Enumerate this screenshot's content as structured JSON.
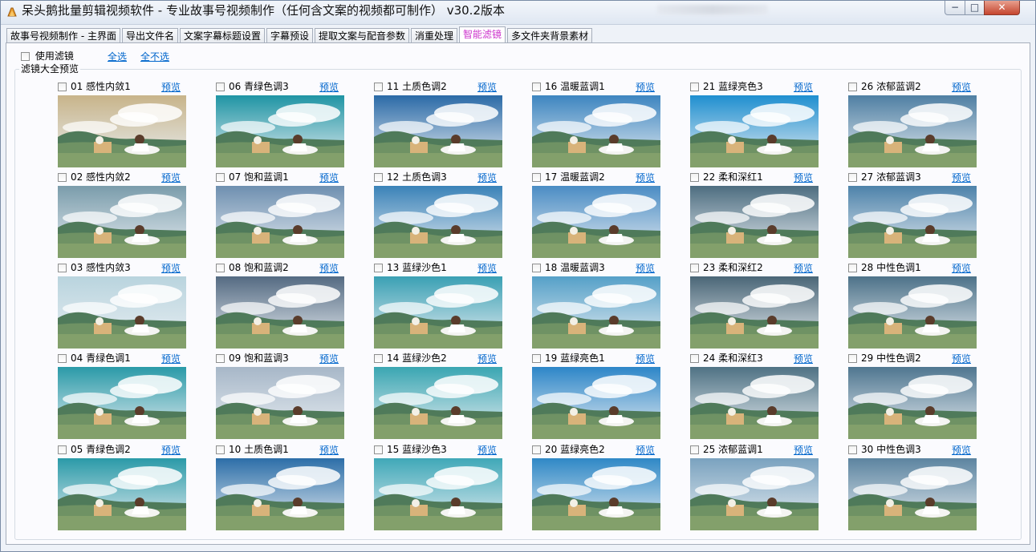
{
  "window": {
    "title": "呆头鹅批量剪辑视频软件 -  专业故事号视频制作（任何含文案的视频都可制作） v30.2版本",
    "controls": [
      "−",
      "□",
      "✕"
    ]
  },
  "tabs": [
    {
      "label": "故事号视频制作 - 主界面",
      "active": false
    },
    {
      "label": "导出文件名",
      "active": false
    },
    {
      "label": "文案字幕标题设置",
      "active": false
    },
    {
      "label": "字幕预设",
      "active": false
    },
    {
      "label": "提取文案与配音参数",
      "active": false
    },
    {
      "label": "消重处理",
      "active": false
    },
    {
      "label": "智能滤镜",
      "active": true
    },
    {
      "label": "多文件夹背景素材",
      "active": false
    }
  ],
  "options": {
    "use_filter_label": "使用滤镜",
    "select_all": "全选",
    "select_none": "全不选"
  },
  "group_title": "滤镜大全预览",
  "preview_link": "预览",
  "filters": [
    {
      "label": "01 感性内敛1",
      "tint": "#c8b48a"
    },
    {
      "label": "02 感性内敛2",
      "tint": "#7a9cab"
    },
    {
      "label": "03 感性内敛3",
      "tint": "#b9d4de"
    },
    {
      "label": "04 青绿色调1",
      "tint": "#2a9aa8"
    },
    {
      "label": "05 青绿色调2",
      "tint": "#2a9aa8"
    },
    {
      "label": "06 青绿色调3",
      "tint": "#1f94a4"
    },
    {
      "label": "07 饱和蓝调1",
      "tint": "#6e8fb0"
    },
    {
      "label": "08 饱和蓝调2",
      "tint": "#546a82"
    },
    {
      "label": "09 饱和蓝调3",
      "tint": "#a7b7c8"
    },
    {
      "label": "10 土质色调1",
      "tint": "#2c6ea8"
    },
    {
      "label": "11 土质色调2",
      "tint": "#2b6aa7"
    },
    {
      "label": "12 土质色调3",
      "tint": "#3a82b8"
    },
    {
      "label": "13 蓝绿沙色1",
      "tint": "#3aa0b4"
    },
    {
      "label": "14 蓝绿沙色2",
      "tint": "#3aa6b2"
    },
    {
      "label": "15 蓝绿沙色3",
      "tint": "#3fa8b8"
    },
    {
      "label": "16 温暖蓝调1",
      "tint": "#3d85c0"
    },
    {
      "label": "17 温暖蓝调2",
      "tint": "#4a8cc4"
    },
    {
      "label": "18 温暖蓝调3",
      "tint": "#55a0c8"
    },
    {
      "label": "19 蓝绿亮色1",
      "tint": "#2d86c8"
    },
    {
      "label": "20 蓝绿亮色2",
      "tint": "#2f88c6"
    },
    {
      "label": "21 蓝绿亮色3",
      "tint": "#1f8fd0"
    },
    {
      "label": "22 柔和深红1",
      "tint": "#4d6d80"
    },
    {
      "label": "23 柔和深红2",
      "tint": "#4a6677"
    },
    {
      "label": "24 柔和深红3",
      "tint": "#4f7284"
    },
    {
      "label": "25 浓郁蓝调1",
      "tint": "#7aa2bf"
    },
    {
      "label": "26 浓郁蓝调2",
      "tint": "#4f7fa3"
    },
    {
      "label": "27 浓郁蓝调3",
      "tint": "#4d82aa"
    },
    {
      "label": "28 中性色调1",
      "tint": "#4d7289"
    },
    {
      "label": "29 中性色调2",
      "tint": "#4f7690"
    },
    {
      "label": "30 中性色调3",
      "tint": "#5c84a0"
    }
  ]
}
